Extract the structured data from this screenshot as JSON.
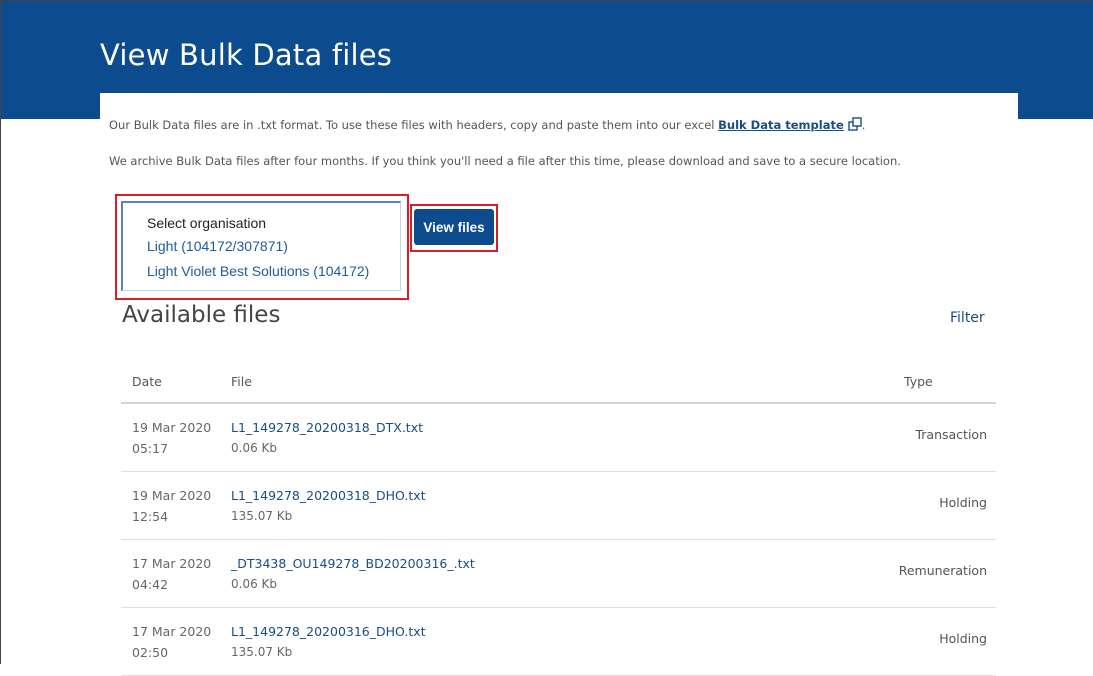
{
  "page": {
    "title": "View Bulk Data files",
    "intro_text": "Our Bulk Data files are in .txt format. To use these files with headers, copy and paste them into our excel",
    "template_link": "Bulk Data template",
    "intro_end": ".",
    "archive_note": "We archive Bulk Data files after four months. If you think you'll need a file after this time, please download and save to a secure location."
  },
  "organisation_select": {
    "options": [
      "Select organisation",
      "Light (104172/307871)",
      "Light Violet Best Solutions (104172)"
    ]
  },
  "view_button": {
    "label": "View files"
  },
  "files": {
    "section_title": "Available files",
    "filter_label": "Filter",
    "columns": {
      "date": "Date",
      "file": "File",
      "type": "Type"
    },
    "rows": [
      {
        "date": "19 Mar 2020",
        "time": "05:17",
        "file_name": "L1_149278_20200318_DTX.txt",
        "size": "0.06 Kb",
        "type": "Transaction"
      },
      {
        "date": "19 Mar 2020",
        "time": "12:54",
        "file_name": "L1_149278_20200318_DHO.txt",
        "size": "135.07 Kb",
        "type": "Holding"
      },
      {
        "date": "17 Mar 2020",
        "time": "04:42",
        "file_name": "_DT3438_OU149278_BD20200316_.txt",
        "size": "0.06 Kb",
        "type": "Remuneration"
      },
      {
        "date": "17 Mar 2020",
        "time": "02:50",
        "file_name": "L1_149278_20200316_DHO.txt",
        "size": "135.07 Kb",
        "type": "Holding"
      }
    ]
  },
  "colors": {
    "brand_blue": "#0c4b8e",
    "link_blue": "#1a4d86",
    "highlight_red": "#d61f26"
  }
}
